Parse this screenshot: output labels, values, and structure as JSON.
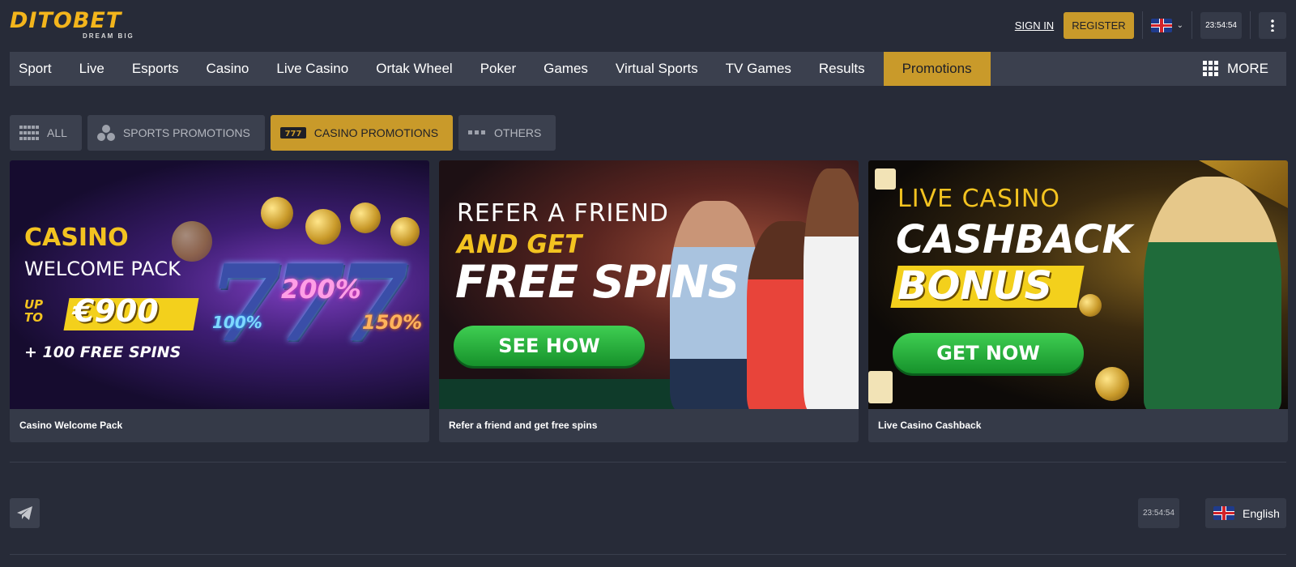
{
  "header": {
    "logo": "DITOBET",
    "logo_tagline": "DREAM BIG",
    "sign_in": "SIGN IN",
    "register": "REGISTER",
    "clock": "23:54:54"
  },
  "nav": {
    "items": [
      "Sport",
      "Live",
      "Esports",
      "Casino",
      "Live Casino",
      "Ortak Wheel",
      "Poker",
      "Games",
      "Virtual Sports",
      "TV Games",
      "Results",
      "Promotions"
    ],
    "active": "Promotions",
    "more": "MORE"
  },
  "filters": [
    {
      "label": "ALL",
      "icon": "grid-icon"
    },
    {
      "label": "SPORTS PROMOTIONS",
      "icon": "balls-icon"
    },
    {
      "label": "CASINO PROMOTIONS",
      "icon": "slot-777-icon"
    },
    {
      "label": "OTHERS",
      "icon": "dots-icon"
    }
  ],
  "active_filter": "CASINO PROMOTIONS",
  "cards": [
    {
      "title": "Casino Welcome Pack",
      "banner": {
        "line1": "CASINO",
        "line2": "WELCOME PACK",
        "upto": "UP TO",
        "amount": "€900",
        "extra": "+ 100 FREE SPINS",
        "pct1": "100%",
        "pct2": "200%",
        "pct3": "150%",
        "sevens": "777"
      }
    },
    {
      "title": "Refer a friend and get free spins",
      "banner": {
        "line1": "REFER A FRIEND",
        "line2": "AND GET",
        "line3": "FREE SPINS",
        "button": "SEE HOW"
      }
    },
    {
      "title": "Live Casino Cashback",
      "banner": {
        "line1": "LIVE CASINO",
        "line2": "CASHBACK",
        "line3": "BONUS",
        "button": "GET NOW"
      }
    }
  ],
  "footer": {
    "clock": "23:54:54",
    "language": "English"
  },
  "colors": {
    "accent": "#c99a2a",
    "background": "#272b38",
    "nav_bg": "#3b404e"
  }
}
